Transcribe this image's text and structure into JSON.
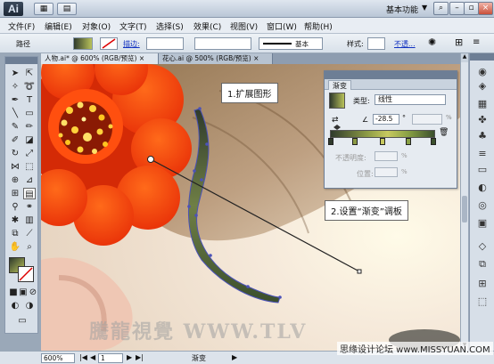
{
  "titlebar": {
    "logo": "Ai",
    "workspace": "基本功能",
    "workspace_arrow": "▼"
  },
  "menu": [
    "文件(F)",
    "编辑(E)",
    "对象(O)",
    "文字(T)",
    "选择(S)",
    "效果(C)",
    "视图(V)",
    "窗口(W)",
    "帮助(H)"
  ],
  "control": {
    "object_type": "路径",
    "stroke_label": "描边:",
    "stroke_style": "基本",
    "style_label": "样式:",
    "opacity_label": "不透..."
  },
  "tabs": [
    {
      "label": "人物.ai* @ 600% (RGB/预览)",
      "close": "×"
    },
    {
      "label": "花心.ai @ 500% (RGB/预览)",
      "close": "×"
    }
  ],
  "gradient_panel": {
    "tab": "渐变",
    "type_label": "类型:",
    "type_value": "线性",
    "angle_value": "-28.5",
    "angle_unit": "°",
    "percent": "%",
    "opacity_label": "不透明度:",
    "location_label": "位置:",
    "stop_colors": [
      "#2f3a2c",
      "#8c9a45",
      "#c7c95f",
      "#88a044",
      "#3b4f2d"
    ]
  },
  "callouts": {
    "step1": "1.扩展图形",
    "step2": "2.设置“渐变”调板"
  },
  "status": {
    "zoom": "600%",
    "page": "1",
    "tool_info": "渐变"
  },
  "watermarks": {
    "main": "騰龍視覺 WWW.TLV",
    "site": "思缘设计论坛 www.MISSYUAN.COM"
  }
}
